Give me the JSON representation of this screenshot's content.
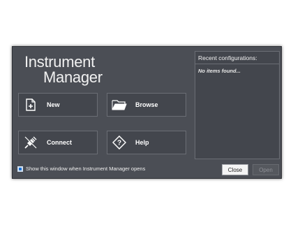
{
  "window": {
    "title_line1": "Instrument",
    "title_line2": "Manager"
  },
  "tiles": [
    {
      "label": "New",
      "icon": "new-document-icon"
    },
    {
      "label": "Browse",
      "icon": "folder-icon"
    },
    {
      "label": "Connect",
      "icon": "plug-icon"
    },
    {
      "label": "Help",
      "icon": "help-icon"
    }
  ],
  "recent": {
    "header": "Recent configurations:",
    "empty_text": "No items found..."
  },
  "footer": {
    "checkbox_label": "Show this window when Instrument Manager opens",
    "checkbox_checked": true,
    "close_label": "Close",
    "open_label": "Open"
  },
  "colors": {
    "window_bg": "#4b4e55",
    "tile_bg": "#43464d",
    "border": "#6b6e75",
    "accent": "#1e73d6"
  }
}
